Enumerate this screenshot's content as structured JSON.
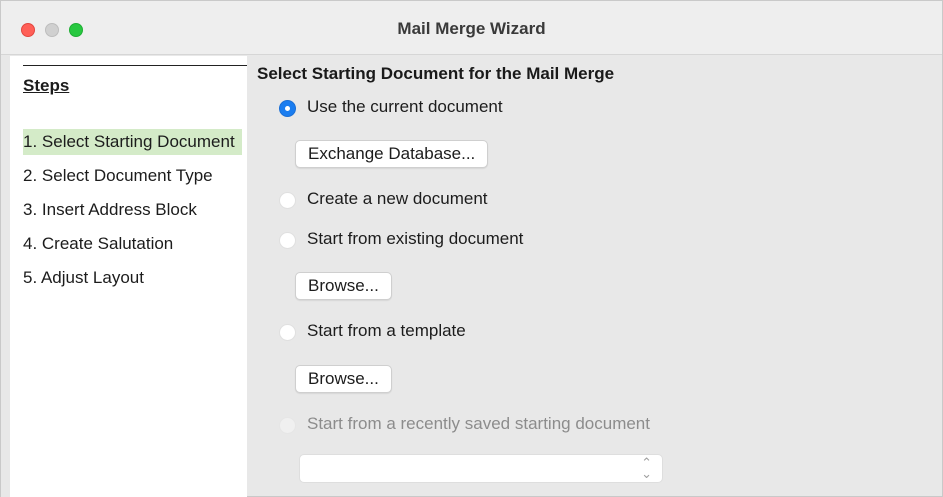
{
  "window": {
    "title": "Mail Merge Wizard"
  },
  "sidebar": {
    "heading": "Steps",
    "items": [
      {
        "label": "1. Select Starting Document",
        "active": true
      },
      {
        "label": "2. Select Document Type",
        "active": false
      },
      {
        "label": "3. Insert Address Block",
        "active": false
      },
      {
        "label": "4. Create Salutation",
        "active": false
      },
      {
        "label": "5. Adjust Layout",
        "active": false
      }
    ]
  },
  "main": {
    "section_title": "Select Starting Document for the Mail Merge",
    "options": {
      "current": {
        "label": "Use the current document",
        "selected": true,
        "enabled": true
      },
      "new": {
        "label": "Create a new document",
        "selected": false,
        "enabled": true
      },
      "existing": {
        "label": "Start from existing document",
        "selected": false,
        "enabled": true
      },
      "template": {
        "label": "Start from a template",
        "selected": false,
        "enabled": true
      },
      "recent": {
        "label": "Start from a recently saved starting document",
        "selected": false,
        "enabled": false
      }
    },
    "buttons": {
      "exchange_database": "Exchange Database...",
      "browse_existing": "Browse...",
      "browse_template": "Browse..."
    },
    "recent_select": {
      "value": ""
    }
  },
  "colors": {
    "accent": "#1a7df0",
    "active_step": "#d4ebc8",
    "close": "#ff5f57",
    "minimize": "#d0d0d0",
    "maximize": "#28c840"
  }
}
